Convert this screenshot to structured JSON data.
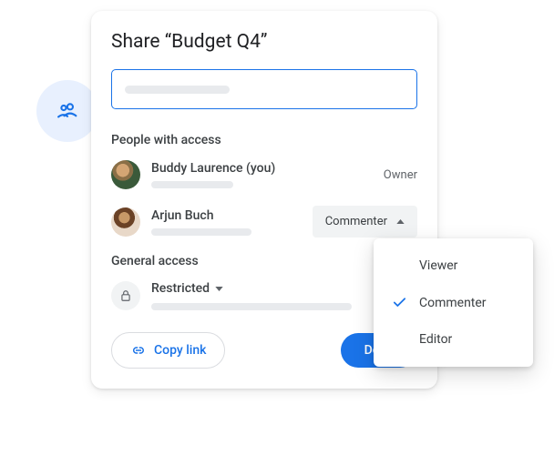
{
  "dialog": {
    "title": "Share “Budget Q4”"
  },
  "input": {
    "placeholder": ""
  },
  "sections": {
    "people_label": "People with access",
    "general_label": "General access"
  },
  "people": [
    {
      "name": "Buddy Laurence (you)",
      "role": "Owner"
    },
    {
      "name": "Arjun Buch",
      "role": "Commenter"
    }
  ],
  "general": {
    "value": "Restricted"
  },
  "actions": {
    "copy_link": "Copy link",
    "done": "Done"
  },
  "menu": {
    "items": [
      "Viewer",
      "Commenter",
      "Editor"
    ],
    "selected": "Commenter"
  }
}
